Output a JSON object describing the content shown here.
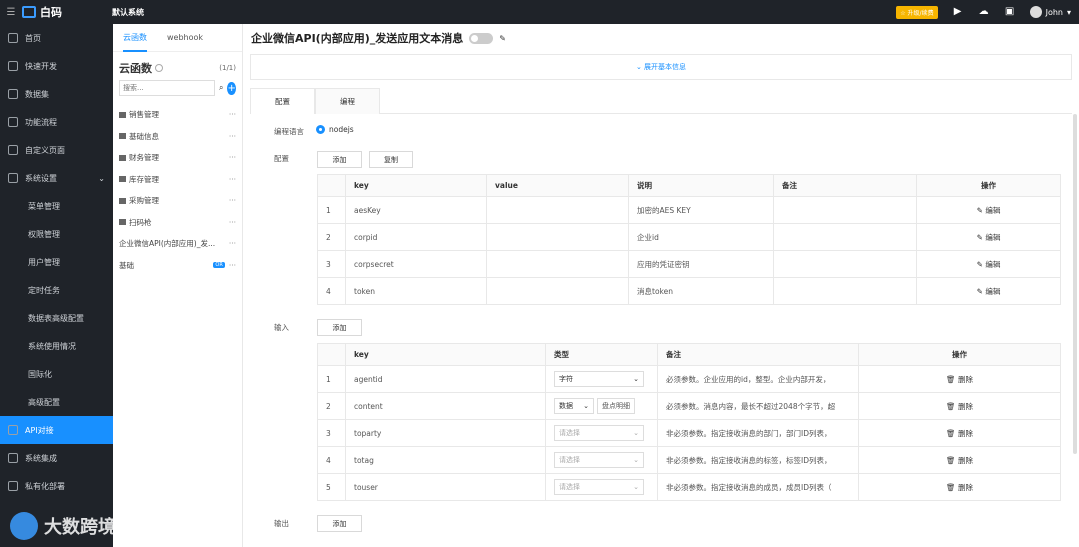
{
  "topbar": {
    "logo_text": "白码",
    "project": "默认系统",
    "upgrade": "☆ 升级/续费",
    "user": "John"
  },
  "sidebar": {
    "items": [
      {
        "label": "首页",
        "icon": "home-icon"
      },
      {
        "label": "快速开发",
        "icon": "cube-icon"
      },
      {
        "label": "数据集",
        "icon": "database-icon"
      },
      {
        "label": "功能流程",
        "icon": "flow-icon"
      },
      {
        "label": "自定义页面",
        "icon": "page-icon"
      },
      {
        "label": "系统设置",
        "icon": "monitor-icon"
      }
    ],
    "sub_items": [
      "菜单管理",
      "权限管理",
      "用户管理",
      "定时任务",
      "数据表高级配置",
      "系统使用情况",
      "国际化",
      "高级配置"
    ],
    "bottom_items": [
      {
        "label": "API对接",
        "icon": "api-icon"
      },
      {
        "label": "系统集成",
        "icon": "integration-icon"
      },
      {
        "label": "私有化部署",
        "icon": "deploy-icon"
      }
    ],
    "watermark": "大数跨境"
  },
  "panel": {
    "tabs": [
      "云函数",
      "webhook"
    ],
    "title": "云函数",
    "count": "(1/1)",
    "search_placeholder": "搜索...",
    "tree": [
      "销售管理",
      "基础信息",
      "财务管理",
      "库存管理",
      "采购管理",
      "扫码枪"
    ],
    "leaf1": "企业微信API(内部应用)_发...",
    "leaf2": "基础",
    "leaf2_badge": "OR"
  },
  "main": {
    "title": "企业微信API(内部应用)_发送应用文本消息",
    "expand": "展开基本信息",
    "tabs": [
      "配置",
      "编程"
    ],
    "lang_label": "编程语言",
    "lang_value": "nodejs",
    "config_label": "配置",
    "add": "添加",
    "copy": "复制",
    "input_label": "输入",
    "output_label": "输出",
    "config_headers": [
      "key",
      "value",
      "说明",
      "备注",
      "操作"
    ],
    "config_rows": [
      {
        "n": "1",
        "key": "aesKey",
        "value": "",
        "desc": "加密的AES KEY",
        "note": "",
        "op": "编辑"
      },
      {
        "n": "2",
        "key": "corpid",
        "value": "",
        "desc": "企业id",
        "note": "",
        "op": "编辑"
      },
      {
        "n": "3",
        "key": "corpsecret",
        "value": "",
        "desc": "应用的凭证密钥",
        "note": "",
        "op": "编辑"
      },
      {
        "n": "4",
        "key": "token",
        "value": "",
        "desc": "消息token",
        "note": "",
        "op": "编辑"
      }
    ],
    "input_headers": [
      "key",
      "类型",
      "备注",
      "操作"
    ],
    "input_rows": [
      {
        "n": "1",
        "key": "agentid",
        "type": "字符",
        "note": "必须参数。企业应用的id，整型。企业内部开发，",
        "op": "删除"
      },
      {
        "n": "2",
        "key": "content",
        "type": "数据",
        "extra": "盘点明细",
        "note": "必须参数。消息内容，最长不超过2048个字节，超",
        "op": "删除"
      },
      {
        "n": "3",
        "key": "toparty",
        "type": "请选择",
        "note": "非必须参数。指定接收消息的部门，部门ID列表，",
        "op": "删除"
      },
      {
        "n": "4",
        "key": "totag",
        "type": "请选择",
        "note": "非必须参数。指定接收消息的标签，标签ID列表，",
        "op": "删除"
      },
      {
        "n": "5",
        "key": "touser",
        "type": "请选择",
        "note": "非必须参数。指定接收消息的成员，成员ID列表（",
        "op": "删除"
      }
    ]
  }
}
